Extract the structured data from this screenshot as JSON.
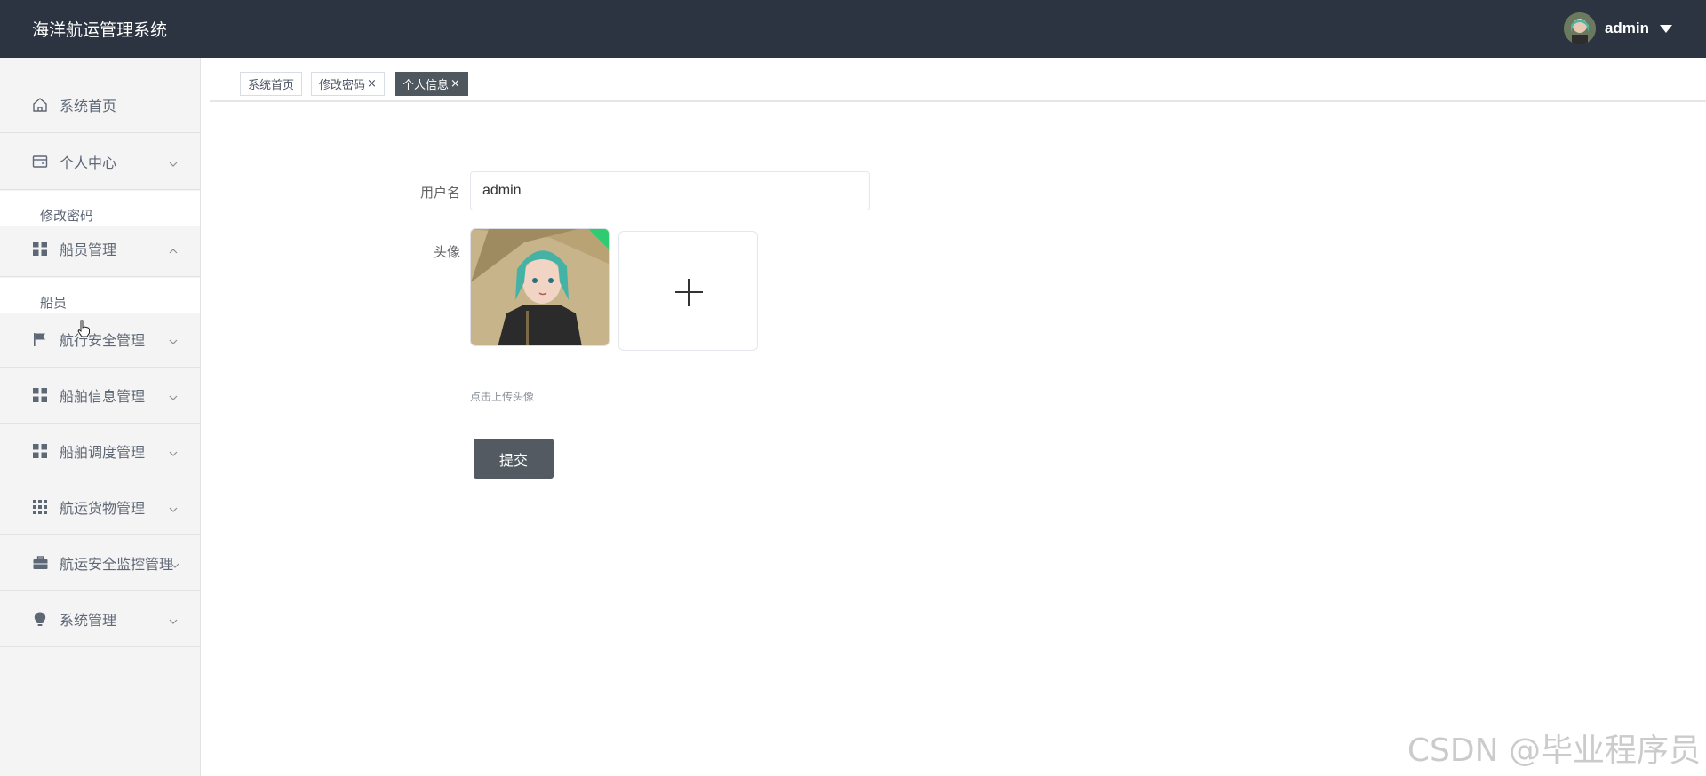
{
  "header": {
    "app_title": "海洋航运管理系统",
    "user_name": "admin",
    "avatar_icon": "user-avatar-icon",
    "dropdown_icon": "caret-down-icon",
    "background_color": "#2b3440"
  },
  "sidebar": {
    "items": [
      {
        "label": "系统首页",
        "icon": "home-icon",
        "arrow": ""
      },
      {
        "label": "个人中心",
        "icon": "card-icon",
        "arrow": "chevron-down",
        "children": [
          "修改密码"
        ]
      },
      {
        "label": "船员管理",
        "icon": "grid-icon",
        "arrow": "chevron-up",
        "children": [
          "船员"
        ]
      },
      {
        "label": "航行安全管理",
        "icon": "flag-icon",
        "arrow": "chevron-down"
      },
      {
        "label": "船舶信息管理",
        "icon": "grid-icon",
        "arrow": "chevron-down"
      },
      {
        "label": "船舶调度管理",
        "icon": "grid-icon",
        "arrow": "chevron-down"
      },
      {
        "label": "航运货物管理",
        "icon": "apps-icon",
        "arrow": "chevron-down"
      },
      {
        "label": "航运安全监控管理",
        "icon": "briefcase-icon",
        "arrow": "chevron-down"
      },
      {
        "label": "系统管理",
        "icon": "bulb-icon",
        "arrow": "chevron-down"
      }
    ]
  },
  "tabs": [
    {
      "label": "系统首页",
      "closable": false,
      "active": false
    },
    {
      "label": "修改密码",
      "closable": true,
      "active": false
    },
    {
      "label": "个人信息",
      "closable": true,
      "active": true
    }
  ],
  "tab_close_glyph": "×",
  "form": {
    "username_label": "用户名",
    "username_value": "admin",
    "avatar_label": "头像",
    "upload_tip": "点击上传头像",
    "submit_label": "提交",
    "submit_color": "#535a62"
  },
  "watermark": "CSDN @毕业程序员"
}
